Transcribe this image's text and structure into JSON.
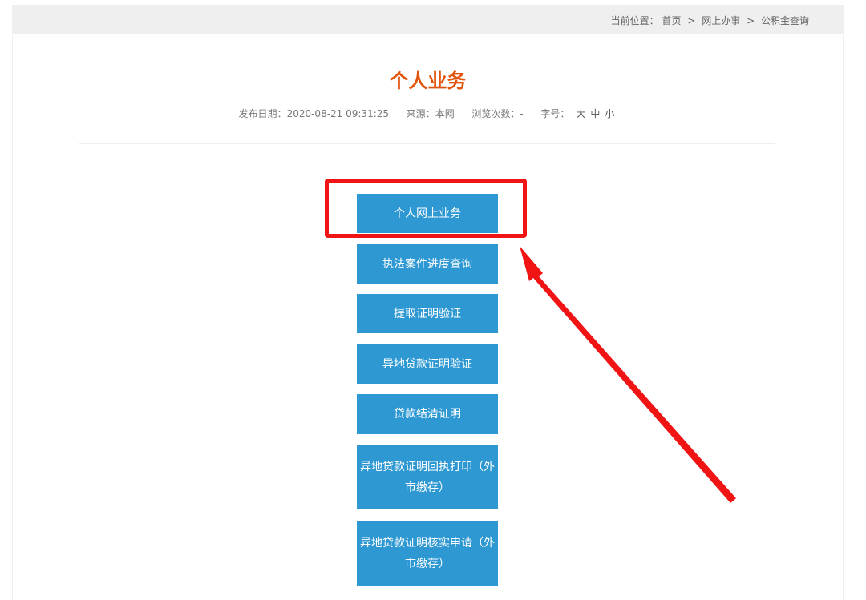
{
  "breadcrumb": {
    "label": "当前位置：",
    "items": [
      "首页",
      "网上办事",
      "公积金查询"
    ],
    "separator": ">"
  },
  "page_title": "个人业务",
  "meta": {
    "publish_date_label": "发布日期：",
    "publish_date": "2020-08-21 09:31:25",
    "source_label": "来源：",
    "source": "本网",
    "views_label": "浏览次数：",
    "views": "-",
    "font_size_label": "字号：",
    "font_sizes": [
      "大",
      "中",
      "小"
    ]
  },
  "buttons": [
    "个人网上业务",
    "执法案件进度查询",
    "提取证明验证",
    "异地贷款证明验证",
    "贷款结清证明",
    "异地贷款证明回执打印（外市缴存）",
    "异地贷款证明核实申请（外市缴存）"
  ],
  "colors": {
    "title": "#e2540c",
    "button": "#2e98d3",
    "annotation": "#f01414"
  }
}
